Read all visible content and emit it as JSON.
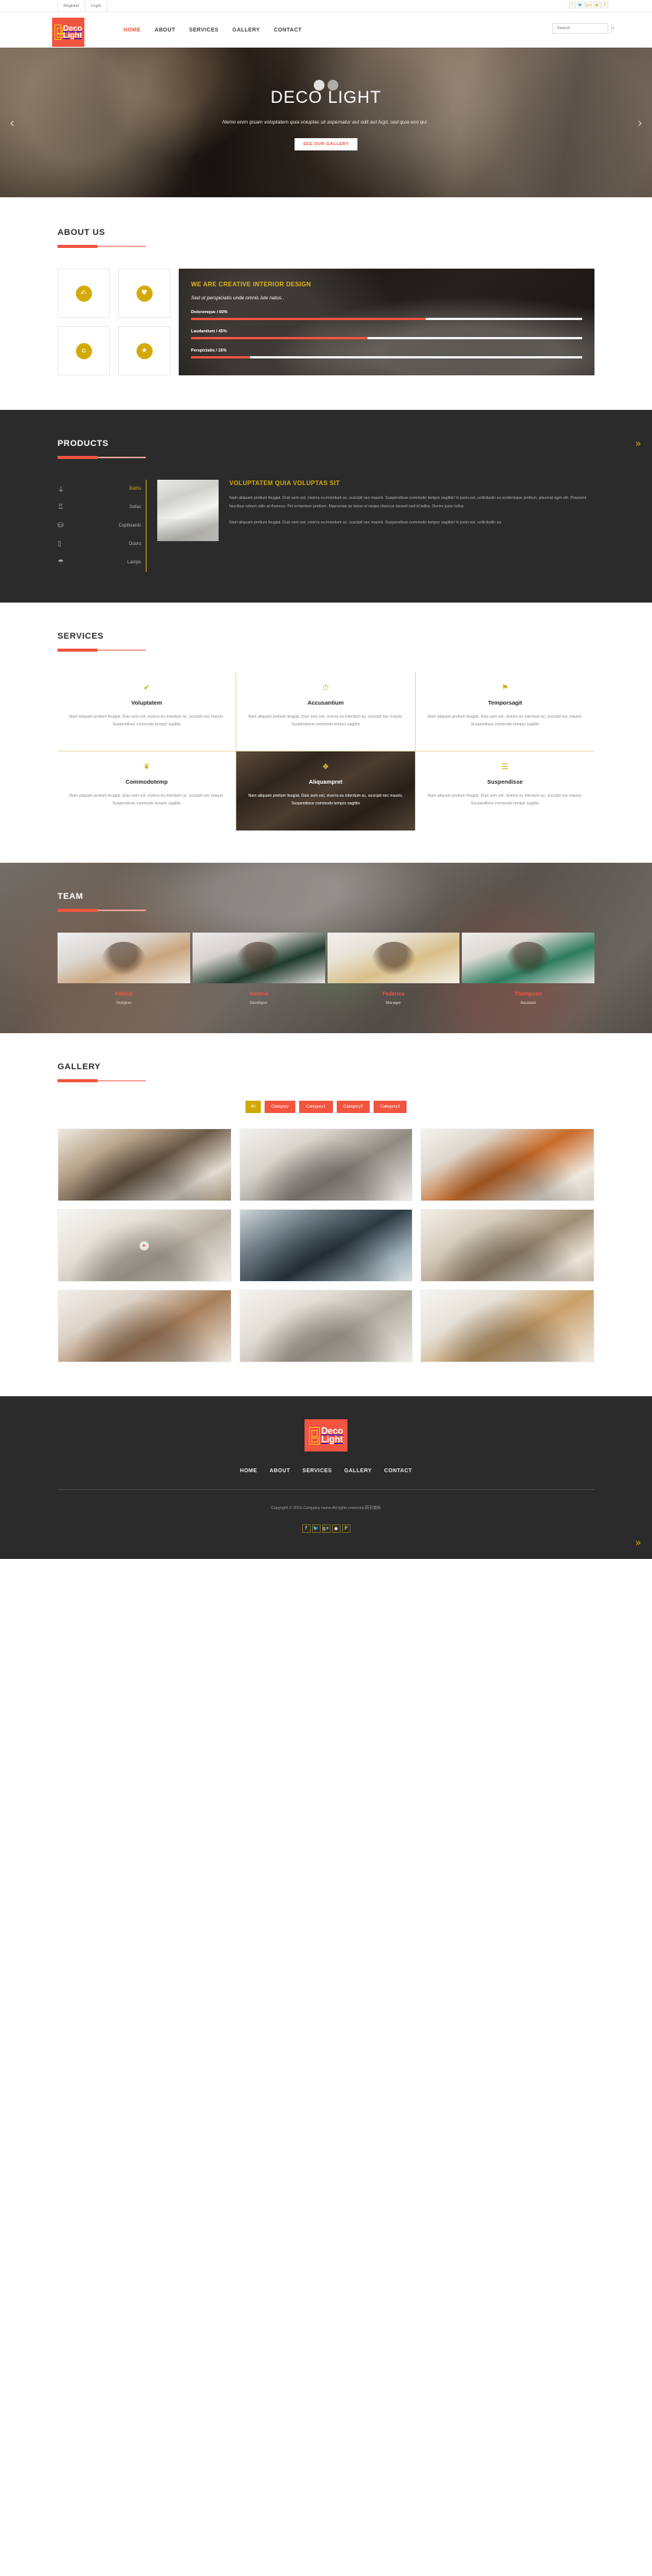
{
  "topbar": {
    "register": "Register",
    "login": "Login",
    "social": [
      "f",
      "🐦",
      "g+",
      "◉",
      "P"
    ]
  },
  "header": {
    "logo_line1": "Deco",
    "logo_line2": "Light",
    "nav": [
      {
        "label": "HOME",
        "active": true
      },
      {
        "label": "ABOUT",
        "active": false
      },
      {
        "label": "SERVICES",
        "active": false
      },
      {
        "label": "GALLERY",
        "active": false
      },
      {
        "label": "CONTACT",
        "active": false
      }
    ],
    "search_placeholder": "Search",
    "search_value": "",
    "search_icon": "⌕"
  },
  "hero": {
    "title": "DECO LIGHT",
    "subtitle": "Nemo enim ipsam voluptatem quia voluptas sit aspernatur aut odit aut fugit, sed quia eos qui .",
    "button": "SEE OUR GALLERY",
    "prev": "‹",
    "next": "›"
  },
  "about": {
    "title": "ABOUT US",
    "cards": [
      {
        "icon": "✍"
      },
      {
        "icon": "♥"
      },
      {
        "icon": "⌂"
      },
      {
        "icon": "★"
      }
    ],
    "panel_title": "WE ARE CREATIVE INTERIOR DESIGN",
    "panel_sub": "Sed ut perspiciatis unde omnis iste natus .",
    "skills": [
      {
        "label": "Doloremque / 60%",
        "value": 60
      },
      {
        "label": "Laudantium / 45%",
        "value": 45
      },
      {
        "label": "Perspiciatis / 15%",
        "value": 15
      }
    ]
  },
  "products": {
    "title": "PRODUCTS",
    "menu": [
      {
        "label": "Baths",
        "icon": "⏚",
        "active": true
      },
      {
        "label": "Sofas",
        "icon": "♖",
        "active": false
      },
      {
        "label": "Cupboards",
        "icon": "⛁",
        "active": false
      },
      {
        "label": "Doors",
        "icon": "▯",
        "active": false
      },
      {
        "label": "Lamps",
        "icon": "☂",
        "active": false
      }
    ],
    "heading": "VOLUPTATEM QUIA VOLUPTAS SIT",
    "paragraph1": "Nam aliquam pretium feugiat. Duis sem est, viverra eu interdum ac, suscipit nec mauris. Suspendisse commodo tempor sagittis! In justo est, sollicitudin eu scelerisque pretium, placerat eget elit. Praesent faucibus rutrum odio at rhoncus. Pel ermentum pretium. Maecenas ac lacus ut neque rhoncus laoreet sed id tellus. Donec justo tellus.",
    "paragraph2": "Nam aliquam pretium feugiat. Duis sem est, viverra eu interdum ac, suscipit nec mauris. Suspendisse commodo tempor sagittis! In justo est, sollicitudin eu.",
    "scroll_top_icon": "»"
  },
  "services": {
    "title": "SERVICES",
    "items": [
      {
        "icon": "✔",
        "name": "Voluptatem",
        "text": "Nam aliquam pretium feugiat. Duis sem est, viverra eu interdum ac, suscipit nec mauris. Suspendisse commodo tempor sagittis",
        "featured": false
      },
      {
        "icon": "⏱",
        "name": "Accusantium",
        "text": "Nam aliquam pretium feugiat. Duis sem est, viverra eu interdum ac, suscipit nec mauris. Suspendisse commodo tempor sagittis",
        "featured": false
      },
      {
        "icon": "⚑",
        "name": "Temporsagit",
        "text": "Nam aliquam pretium feugiat. Duis sem est, viverra eu interdum ac, suscipit nec mauris. Suspendisse commodo tempor sagittis",
        "featured": false
      },
      {
        "icon": "❦",
        "name": "Commodotemp",
        "text": "Nam aliquam pretium feugiat. Duis sem est, viverra eu interdum ac, suscipit nec mauris. Suspendisse commodo tempor sagittis",
        "featured": false
      },
      {
        "icon": "❖",
        "name": "Aliquampret",
        "text": "Nam aliquam pretium feugiat. Duis sem est, viverra eu interdum ac, suscipit nec mauris. Suspendisse commodo tempor sagittis",
        "featured": true
      },
      {
        "icon": "☰",
        "name": "Suspendisse",
        "text": "Nam aliquam pretium feugiat. Duis sem est, viverra eu interdum ac, suscipit nec mauris. Suspendisse commodo tempor sagittis",
        "featured": false
      }
    ]
  },
  "team": {
    "title": "TEAM",
    "members": [
      {
        "name": "Patrick",
        "role": "Designer"
      },
      {
        "name": "Victoria",
        "role": "Developer"
      },
      {
        "name": "Federica",
        "role": "Manager"
      },
      {
        "name": "Thompson",
        "role": "Assistant"
      }
    ]
  },
  "gallery": {
    "title": "GALLERY",
    "filters": [
      {
        "label": "All",
        "active": true
      },
      {
        "label": "Category",
        "active": false
      },
      {
        "label": "Category1",
        "active": false
      },
      {
        "label": "Category2",
        "active": false
      },
      {
        "label": "Category3",
        "active": false
      }
    ],
    "play_icon": "▶",
    "items_count": 9
  },
  "footer": {
    "logo_line1": "Deco",
    "logo_line2": "Light",
    "nav": [
      "HOME",
      "ABOUT",
      "SERVICES",
      "GALLERY",
      "CONTACT"
    ],
    "copyright": "Copyright © 2016.Company name All rights reserved.网页模板",
    "social": [
      "f",
      "🐦",
      "g+",
      "◉",
      "P"
    ],
    "scroll_top_icon": "»"
  },
  "colors": {
    "accent": "#f1543f",
    "gold": "#d4aa09",
    "dark": "#2b2b2b"
  }
}
